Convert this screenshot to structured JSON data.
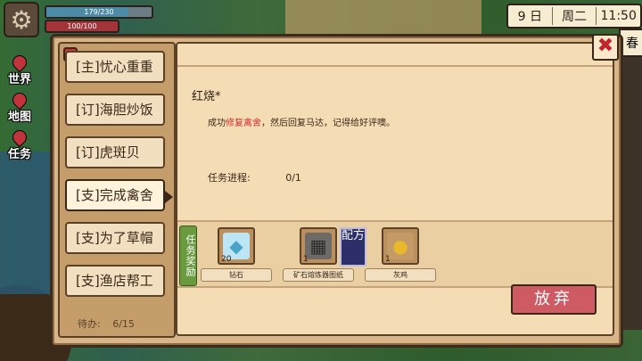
{
  "hud": {
    "hp_text": "179/230",
    "hp_value": 179,
    "hp_max": 230,
    "energy_text": "100/100",
    "date_day": "9 日",
    "weekday": "周二",
    "time": "11:50",
    "season": "春",
    "side_icons": [
      {
        "label": "世界"
      },
      {
        "label": "地图"
      },
      {
        "label": "任务"
      }
    ]
  },
  "quest_list": {
    "items": [
      {
        "label": "[主]忧心重重"
      },
      {
        "label": "[订]海胆炒饭"
      },
      {
        "label": "[订]虎斑贝"
      },
      {
        "label": "[支]完成禽舍"
      },
      {
        "label": "[支]为了草帽"
      },
      {
        "label": "[支]渔店帮工"
      }
    ],
    "pending_label": "待办:",
    "pending_count": "6/15"
  },
  "quest_detail": {
    "title": "红烧*",
    "desc_prefix": "成功",
    "desc_highlight": "修复禽舍",
    "desc_suffix": "，然后回复马达，记得给好评噢。",
    "progress_label": "任务进程:",
    "progress_value": "0/1",
    "reward_label": "任务奖励",
    "rewards": [
      {
        "name": "钻石",
        "count": "20",
        "icon": "diamond-icon"
      },
      {
        "name": "矿石熔炼器图纸",
        "count": "1",
        "icon": "smelter-blueprint-icon"
      },
      {
        "name": "灰鸡",
        "count": "1",
        "icon": "chick-icon"
      }
    ],
    "recipe_tag": "配方",
    "abandon_label": "放弃"
  },
  "colors": {
    "panel": "#d8b688",
    "detail": "#f4dcb5",
    "highlight": "#d02e2e",
    "abandon": "#ce5a63",
    "reward_tag": "#6a9a3f"
  }
}
